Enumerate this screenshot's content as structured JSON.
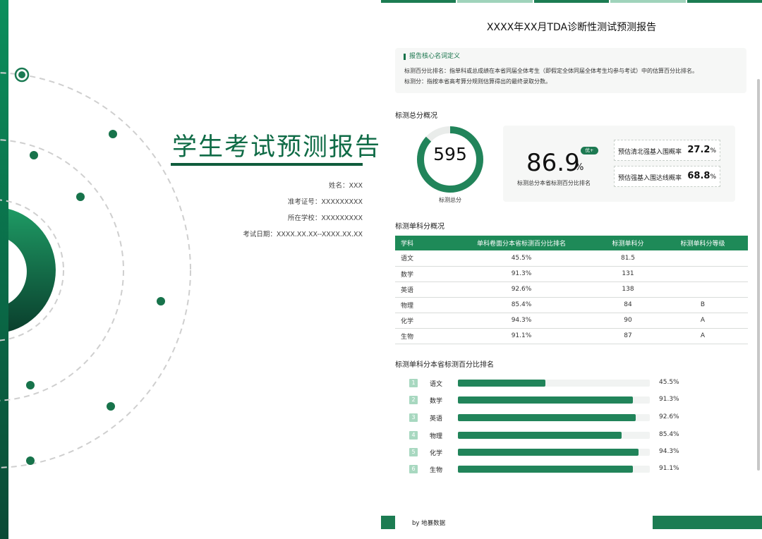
{
  "cover": {
    "title": "学生考试预测报告",
    "info": [
      {
        "label": "姓名：",
        "value": "XXX"
      },
      {
        "label": "准考证号：",
        "value": "XXXXXXXXX"
      },
      {
        "label": "所在学校：",
        "value": "XXXXXXXXX"
      },
      {
        "label": "考试日期：",
        "value": "XXXX.XX.XX--XXXX.XX.XX"
      }
    ]
  },
  "report": {
    "title": "XXXX年XX月TDA诊断性测试预测报告",
    "definitions": {
      "heading": "报告核心名词定义",
      "lines": [
        "标测百分比排名：指单科或总成绩在本省同届全体考生（即假定全体同届全体考生均参与考试）中的估算百分比排名。",
        "标测分：指按本省高考算分规则估算得出的最终录取分数。"
      ]
    },
    "total": {
      "section_title": "标测总分概况",
      "score": "595",
      "score_label": "标测总分",
      "gauge_fraction": 0.869,
      "percentile": "86.9",
      "percent_sign": "%",
      "badge": "优+",
      "percentile_label": "标测总分本省标测百分比排名",
      "probabilities": [
        {
          "label": "预估清北强基入围概率",
          "value": "27.2",
          "unit": "%"
        },
        {
          "label": "预估强基入围达线概率",
          "value": "68.8",
          "unit": "%"
        }
      ]
    },
    "subjects": {
      "section_title": "标测单科分概况",
      "headers": [
        "学科",
        "单科卷面分本省标测百分比排名",
        "标测单科分",
        "标测单科分等级"
      ],
      "rows": [
        [
          "语文",
          "45.5%",
          "81.5",
          ""
        ],
        [
          "数学",
          "91.3%",
          "131",
          ""
        ],
        [
          "英语",
          "92.6%",
          "138",
          ""
        ],
        [
          "物理",
          "85.4%",
          "84",
          "B"
        ],
        [
          "化学",
          "94.3%",
          "90",
          "A"
        ],
        [
          "生物",
          "91.1%",
          "87",
          "A"
        ]
      ]
    },
    "ranking": {
      "section_title": "标测单科分本省标测百分比排名",
      "items": [
        {
          "rank": "1",
          "name": "语文",
          "value": 45.5,
          "label": "45.5%"
        },
        {
          "rank": "2",
          "name": "数学",
          "value": 91.3,
          "label": "91.3%"
        },
        {
          "rank": "3",
          "name": "英语",
          "value": 92.6,
          "label": "92.6%"
        },
        {
          "rank": "4",
          "name": "物理",
          "value": 85.4,
          "label": "85.4%"
        },
        {
          "rank": "5",
          "name": "化学",
          "value": 94.3,
          "label": "94.3%"
        },
        {
          "rank": "6",
          "name": "生物",
          "value": 91.1,
          "label": "91.1%"
        }
      ]
    },
    "footer": "by 地暴数据"
  },
  "colors": {
    "accent": "#1e8a58",
    "dark": "#0f5c3c",
    "light": "#a8d8c0"
  }
}
